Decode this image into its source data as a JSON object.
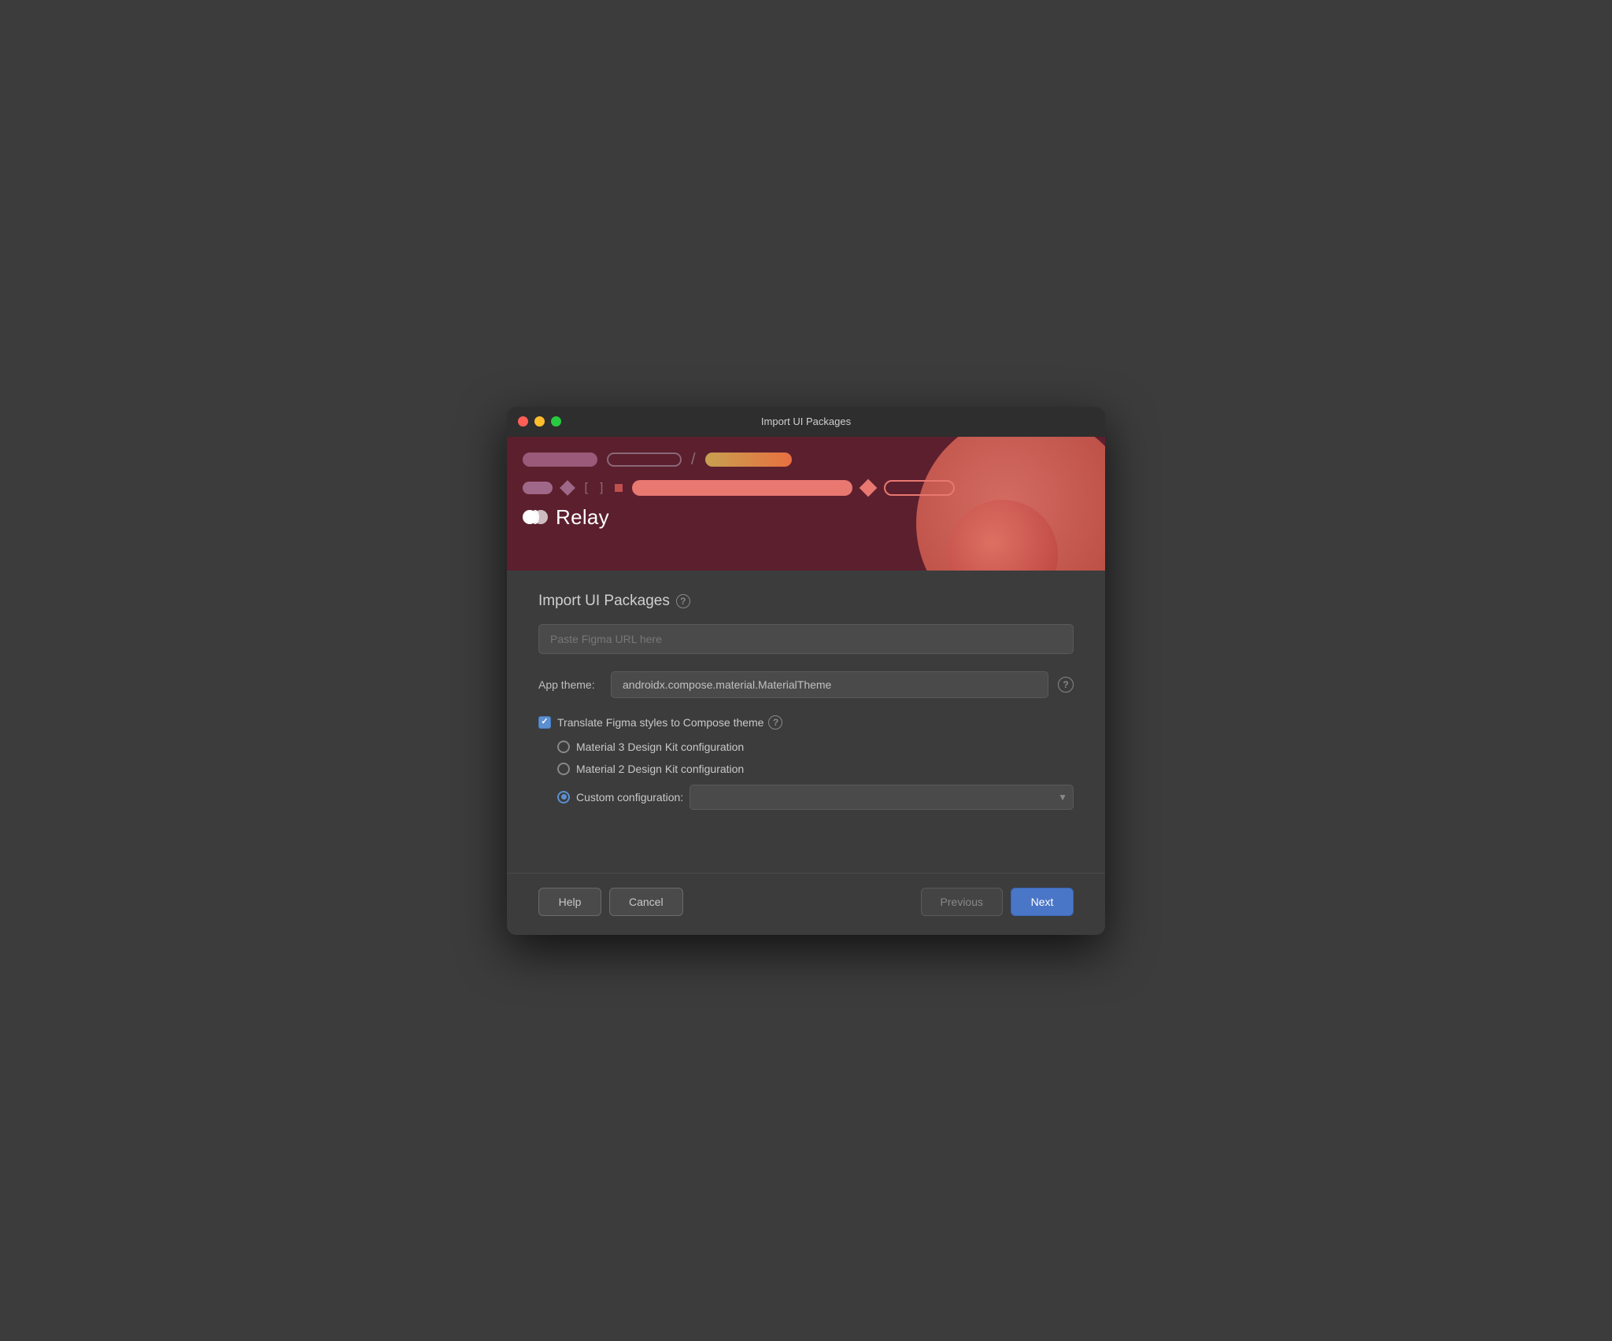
{
  "window": {
    "title": "Import UI Packages"
  },
  "banner": {
    "relay_label": "Relay"
  },
  "content": {
    "section_title": "Import UI Packages",
    "help_icon_label": "?",
    "url_input": {
      "placeholder": "Paste Figma URL here",
      "value": ""
    },
    "app_theme": {
      "label": "App theme:",
      "value": "androidx.compose.material.MaterialTheme",
      "help_icon_label": "?"
    },
    "translate_checkbox": {
      "label": "Translate Figma styles to Compose theme",
      "checked": true,
      "help_icon_label": "?"
    },
    "radio_options": [
      {
        "id": "material3",
        "label": "Material 3 Design Kit configuration",
        "selected": false
      },
      {
        "id": "material2",
        "label": "Material 2 Design Kit configuration",
        "selected": false
      },
      {
        "id": "custom",
        "label": "Custom configuration:",
        "selected": true
      }
    ],
    "custom_config_input": {
      "value": "",
      "placeholder": ""
    }
  },
  "footer": {
    "help_label": "Help",
    "cancel_label": "Cancel",
    "previous_label": "Previous",
    "next_label": "Next"
  }
}
